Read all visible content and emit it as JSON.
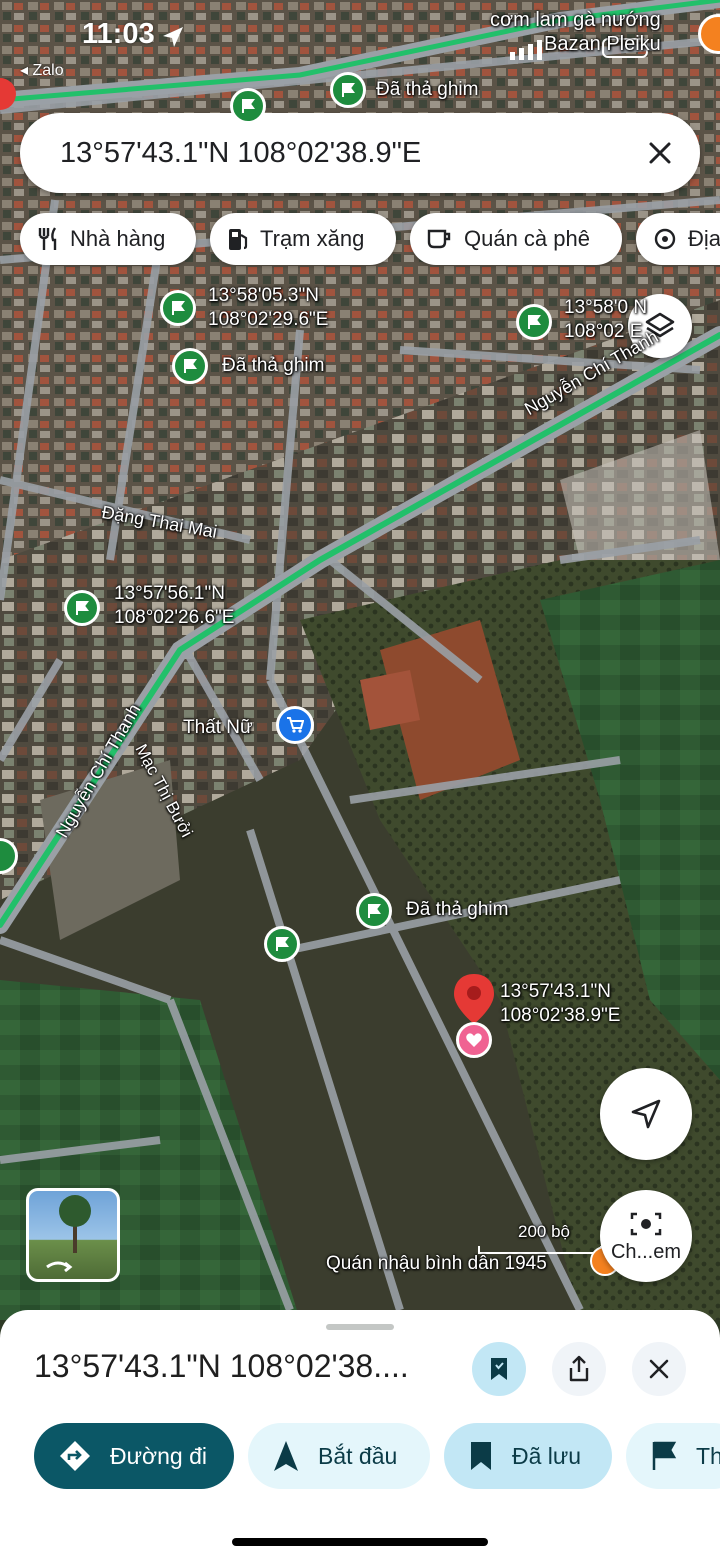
{
  "status_bar": {
    "time": "11:03",
    "back_app": "◂ Zalo"
  },
  "search": {
    "query": "13°57'43.1\"N 108°02'38.9\"E"
  },
  "chips": [
    {
      "label": "Nhà hàng",
      "icon": "fork-knife-icon"
    },
    {
      "label": "Trạm xăng",
      "icon": "gas-pump-icon"
    },
    {
      "label": "Quán cà phê",
      "icon": "coffee-cup-icon"
    },
    {
      "label": "Địa",
      "icon": "landmark-icon"
    }
  ],
  "map": {
    "top_label": "cơm lam gà nướng\nBazan Pleiku",
    "pins": [
      {
        "label": "Đã thả ghim"
      },
      {
        "label": "13°58'05.3\"N\n108°02'29.6\"E"
      },
      {
        "label": "Đã thả ghim"
      },
      {
        "label": "13°58'0 N\n108°02 E"
      },
      {
        "label": "13°57'56.1\"N\n108°02'26.6\"E"
      },
      {
        "label": "Đã thả ghim"
      }
    ],
    "roads": {
      "nguyen_chi_thanh_1": "Nguyễn Chí Thanh",
      "nguyen_chi_thanh_2": "Nguyễn Chí Thanh",
      "dang_thai_mai": "Đặng Thai Mai",
      "mac_thi_buoi": "Mạc Thị Bưởi"
    },
    "store_label": "Thất Nữ",
    "selected_label": "13°57'43.1\"N\n108°02'38.9\"E",
    "bottom_place": "Quán nhậu bình dân 1945",
    "scale": "200 bộ",
    "camera_button": "Ch...em"
  },
  "sheet": {
    "title": "13°57'43.1\"N 108°02'38....",
    "actions": [
      {
        "label": "Đường đi",
        "icon": "directions-icon"
      },
      {
        "label": "Bắt đầu",
        "icon": "navigation-arrow-icon"
      },
      {
        "label": "Đã lưu",
        "icon": "bookmark-icon"
      },
      {
        "label": "Th",
        "icon": "flag-icon"
      }
    ]
  },
  "colors": {
    "primary": "#0b5766",
    "pin_green": "#1e8c3e",
    "road_green": "#22c06a",
    "marker_red": "#e53935",
    "light_blue": "#e4f6fb",
    "saved_blue": "#c2e7f5"
  }
}
